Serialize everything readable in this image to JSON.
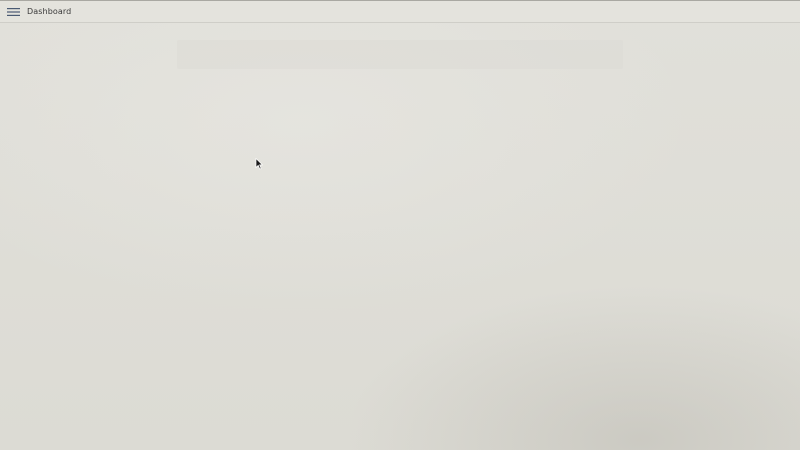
{
  "header": {
    "menu_icon": "hamburger-menu-icon",
    "title": "Dashboard"
  },
  "banner": {
    "left_label": "",
    "right_label": ""
  },
  "colors": {
    "background": "#dfded8",
    "topbar": "#e4e3dd",
    "text": "#3a3a3a",
    "menu_icon": "#4a5a73"
  }
}
